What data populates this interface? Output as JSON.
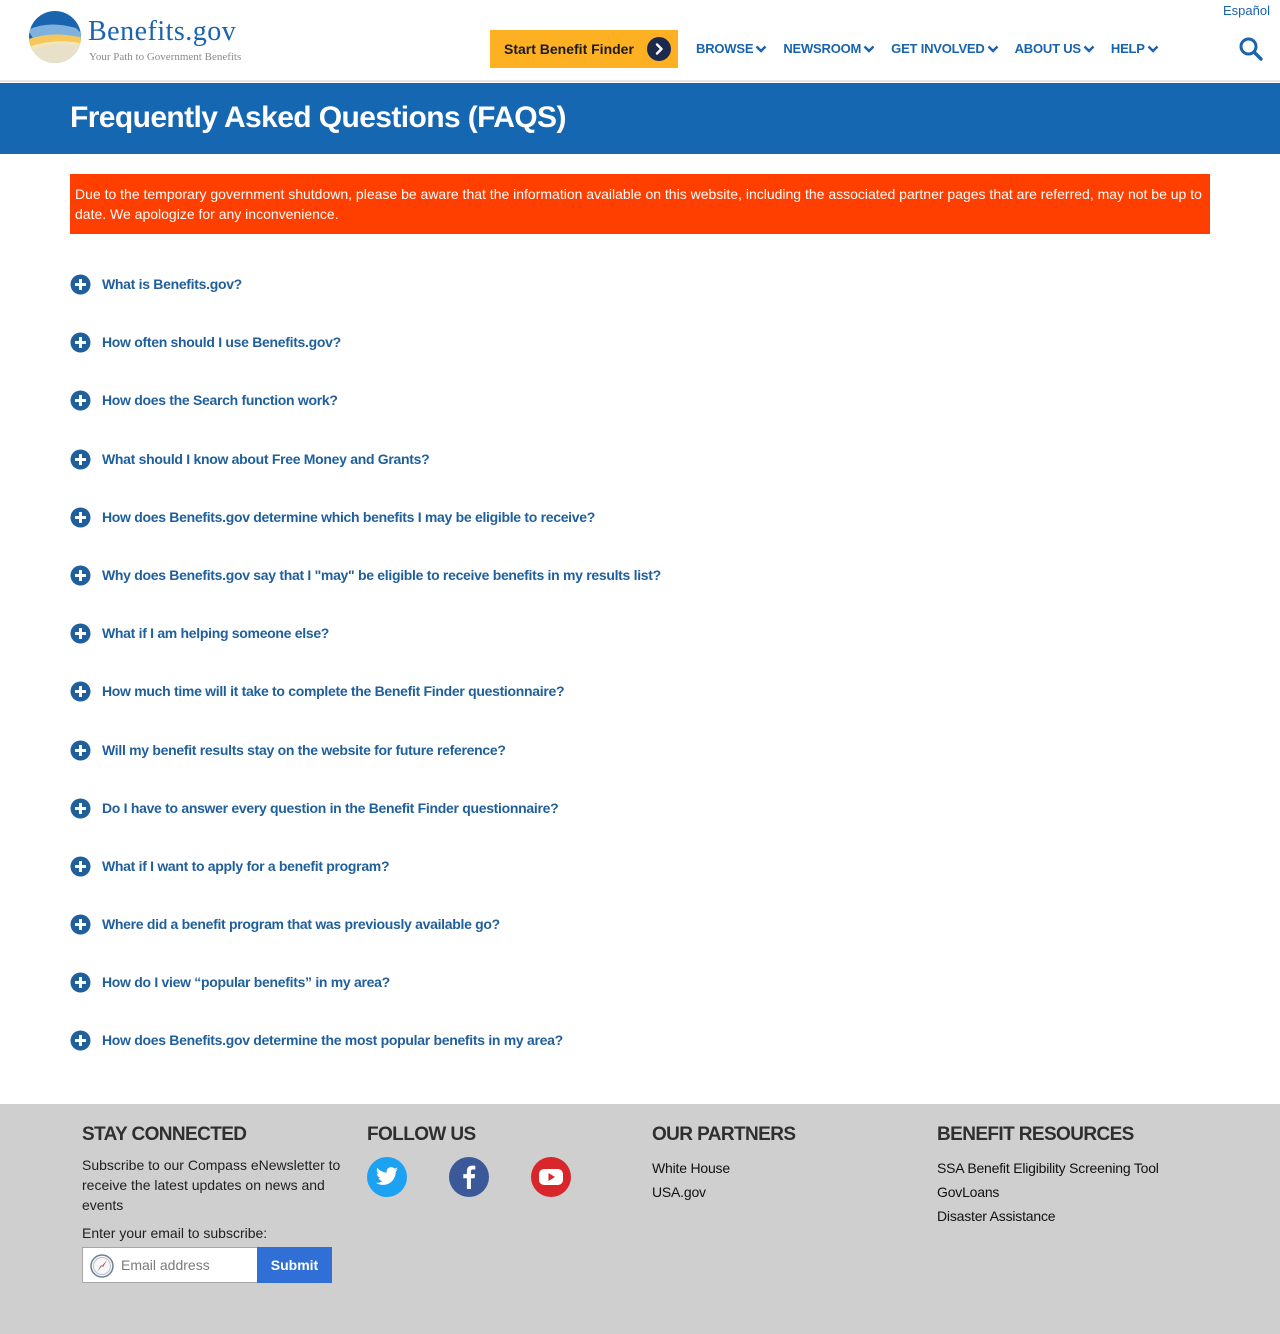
{
  "header": {
    "logo_text": "Benefits.gov",
    "logo_tagline": "Your Path to Government Benefits",
    "language_link": "Español",
    "finder_button": "Start Benefit Finder",
    "nav": [
      {
        "label": "BROWSE"
      },
      {
        "label": "NEWSROOM"
      },
      {
        "label": "GET INVOLVED"
      },
      {
        "label": "ABOUT US"
      },
      {
        "label": "HELP"
      }
    ],
    "search_icon": "search-icon"
  },
  "page": {
    "title": "Frequently Asked Questions (FAQS)",
    "alert": "Due to the temporary government shutdown, please be aware that the information available on this website, including the associated partner pages that are referred, may not be up to date. We apologize for any inconvenience."
  },
  "faqs": [
    {
      "question": "What is Benefits.gov?"
    },
    {
      "question": "How often should I use Benefits.gov?"
    },
    {
      "question": "How does the Search function work?"
    },
    {
      "question": "What should I know about Free Money and Grants?"
    },
    {
      "question": "How does Benefits.gov determine which benefits I may be eligible to receive?"
    },
    {
      "question": "Why does Benefits.gov say that I \"may\" be eligible to receive benefits in my results list?"
    },
    {
      "question": "What if I am helping someone else?"
    },
    {
      "question": "How much time will it take to complete the Benefit Finder questionnaire?"
    },
    {
      "question": "Will my benefit results stay on the website for future reference?"
    },
    {
      "question": "Do I have to answer every question in the Benefit Finder questionnaire?"
    },
    {
      "question": "What if I want to apply for a benefit program?"
    },
    {
      "question": "Where did a benefit program that was previously available go?"
    },
    {
      "question": "How do I view “popular benefits” in my area?"
    },
    {
      "question": "How does Benefits.gov determine the most popular benefits in my area?"
    }
  ],
  "footer": {
    "stay_connected": {
      "heading": "STAY CONNECTED",
      "description": "Subscribe to our Compass eNewsletter to receive the latest updates on news and events",
      "enter_label": "Enter your email to subscribe:",
      "email_placeholder": "Email address",
      "submit_label": "Submit"
    },
    "follow_us": {
      "heading": "FOLLOW US",
      "icons": [
        "twitter-icon",
        "facebook-icon",
        "youtube-icon"
      ]
    },
    "partners": {
      "heading": "OUR PARTNERS",
      "links": [
        "White House",
        "USA.gov"
      ]
    },
    "resources": {
      "heading": "BENEFIT RESOURCES",
      "links": [
        "SSA Benefit Eligibility Screening Tool",
        "GovLoans",
        "Disaster Assistance"
      ]
    }
  },
  "colors": {
    "brand_blue": "#1667b2",
    "link_blue": "#1f5f9c",
    "finder_orange": "#fdb021",
    "alert_red": "#ff3f00",
    "footer_gray": "#cfcfcf",
    "submit_blue": "#2f6fd6"
  }
}
